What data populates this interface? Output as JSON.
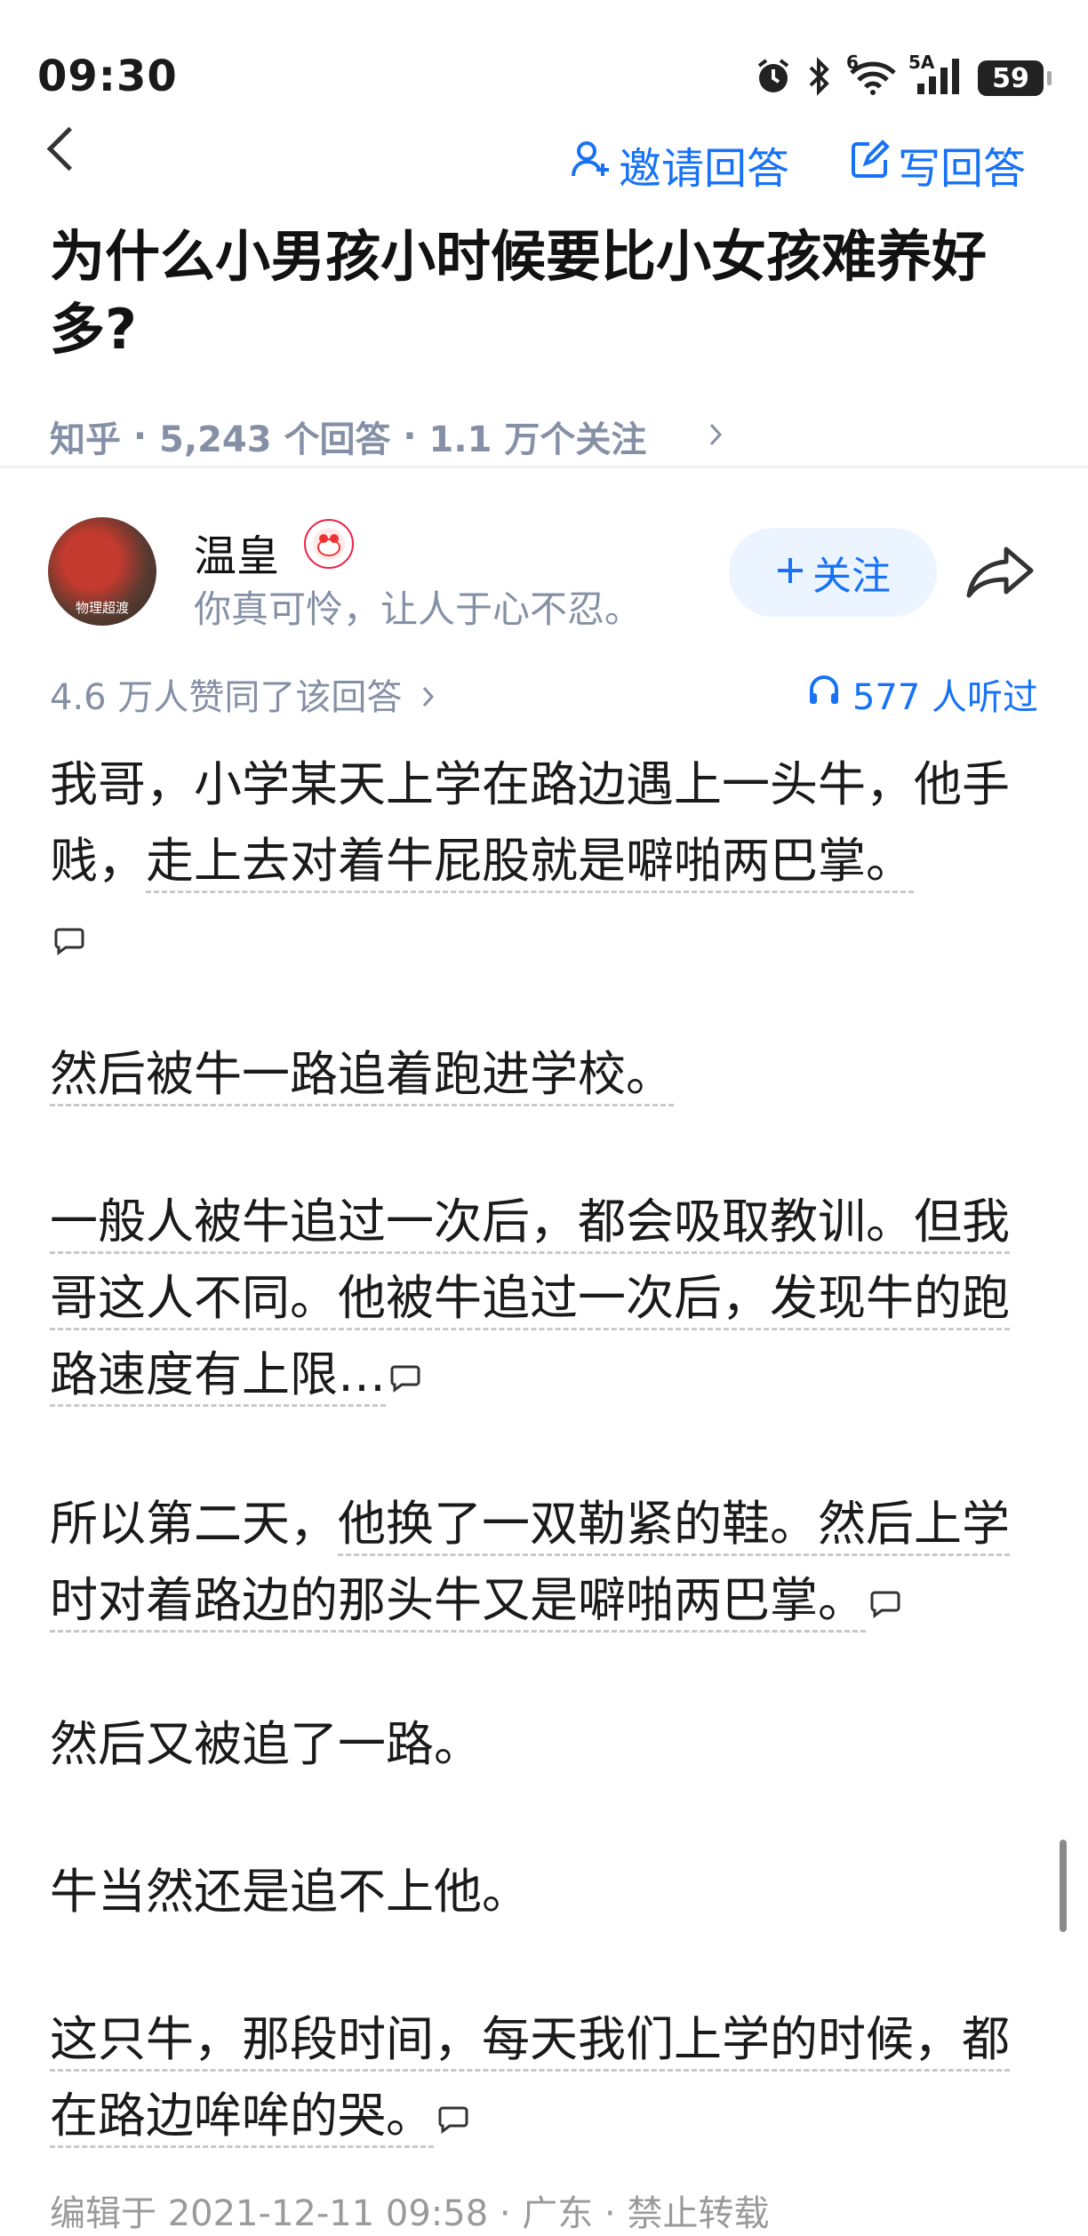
{
  "status_bar": {
    "time": "09:30",
    "network_wifi": "6",
    "network_cell": "5A",
    "battery": "59"
  },
  "nav": {
    "invite_label": "邀请回答",
    "write_label": "写回答"
  },
  "question": {
    "title": "为什么小男孩小时候要比小女孩难养好多?",
    "source": "知乎",
    "answers_count": "5,243 个回答",
    "followers": "1.1 万个关注"
  },
  "author": {
    "name": "温皇",
    "bio": "你真可怜，让人于心不忍。",
    "avatar_caption": "物理超渡",
    "follow_label": "关注"
  },
  "stats": {
    "votes": "4.6 万人赞同了该回答",
    "listened": "577 人听过"
  },
  "paragraphs": [
    {
      "lead": "我哥，小学某天上学在路边遇上一头牛，他手贱，",
      "underlined": "走上去对着牛屁股就是噼啪两巴掌。"
    },
    {
      "lead": "",
      "underlined": "然后被牛一路追着跑进学校。"
    },
    {
      "lead": "",
      "underlined": "一般人被牛追过一次后，都会吸取教训。但我哥这人不同。他被牛追过一次后，发现牛的跑路速度有上限…"
    },
    {
      "lead": "所以第二天，",
      "underlined": "他换了一双勒紧的鞋。然后上学时对着路边的那头牛又是噼啪两巴掌。"
    },
    {
      "lead": "然后又被追了一路。",
      "underlined": ""
    },
    {
      "lead": "牛当然还是追不上他。",
      "underlined": ""
    },
    {
      "lead": "",
      "underlined": "这只牛，那段时间，每天我们上学的时候，都在路边哞哞的哭。"
    }
  ],
  "footer": {
    "edited": "编辑于 2021-12-11 09:58 · 广东 · 禁止转载"
  },
  "colors": {
    "accent": "#1772f6",
    "meta_gray": "#8590a6",
    "follow_bg": "#ebf4ff"
  }
}
